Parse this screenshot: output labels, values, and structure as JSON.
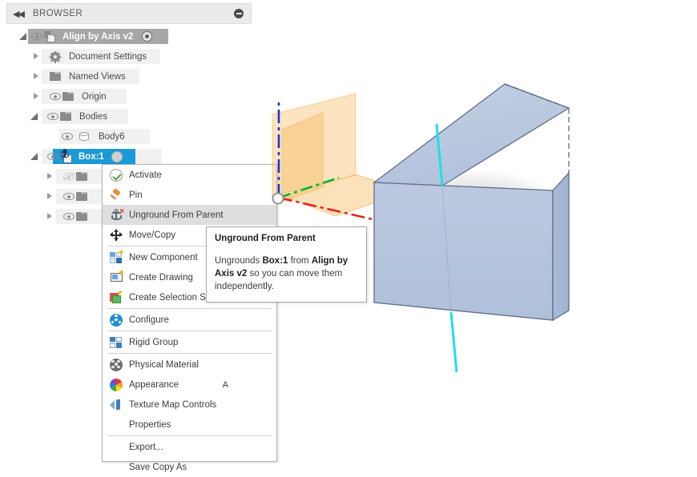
{
  "panel": {
    "header": {
      "title": "BROWSER",
      "collapse_icon": "double-chevron-left-icon",
      "minimize_icon": "minus-circle-icon"
    },
    "tree": [
      {
        "label": "Align by Axis v2",
        "indent": 0,
        "state": "root-active",
        "icons": [
          "expand-open-icon",
          "eye-icon",
          "component-icon",
          "activated-target-icon"
        ]
      },
      {
        "label": "Document Settings",
        "indent": 1,
        "state": "normal",
        "icons": [
          "expand-collapsed-icon",
          "gear-icon"
        ]
      },
      {
        "label": "Named Views",
        "indent": 1,
        "state": "normal",
        "icons": [
          "expand-collapsed-icon",
          "folder-icon"
        ]
      },
      {
        "label": "Origin",
        "indent": 1,
        "state": "normal",
        "icons": [
          "expand-collapsed-icon",
          "eye-icon",
          "folder-icon"
        ]
      },
      {
        "label": "Bodies",
        "indent": 1,
        "state": "normal",
        "icons": [
          "expand-open-icon",
          "eye-icon",
          "folder-icon"
        ]
      },
      {
        "label": "Body6",
        "indent": 2,
        "state": "normal",
        "icons": [
          "eye-icon",
          "body-cylinder-icon"
        ]
      },
      {
        "label": "Box:1",
        "indent": 1,
        "state": "selected",
        "icons": [
          "expand-open-icon",
          "eye-icon",
          "grounded-component-icon",
          "grey-ball-icon"
        ]
      },
      {
        "label": "",
        "indent": 2,
        "state": "hidden-row",
        "icons": [
          "expand-collapsed-icon",
          "eye-off-icon",
          "folder-icon"
        ]
      },
      {
        "label": "",
        "indent": 2,
        "state": "hidden-row",
        "icons": [
          "expand-collapsed-icon",
          "eye-icon",
          "folder-icon"
        ]
      },
      {
        "label": "",
        "indent": 2,
        "state": "hidden-row",
        "icons": [
          "expand-collapsed-icon",
          "eye-icon",
          "folder-icon"
        ]
      }
    ]
  },
  "context_menu": {
    "items": [
      {
        "label": "Activate",
        "icon": "check-circle-icon",
        "accel": "",
        "highlighted": false,
        "separator_after": false
      },
      {
        "label": "Pin",
        "icon": "pin-icon",
        "accel": "",
        "highlighted": false,
        "separator_after": false
      },
      {
        "label": "Unground From Parent",
        "icon": "anchor-remove-icon",
        "accel": "",
        "highlighted": true,
        "separator_after": false
      },
      {
        "label": "Move/Copy",
        "icon": "move-arrows-icon",
        "accel": "",
        "highlighted": false,
        "separator_after": true
      },
      {
        "label": "New Component",
        "icon": "new-component-icon",
        "accel": "",
        "highlighted": false,
        "separator_after": false
      },
      {
        "label": "Create Drawing",
        "icon": "create-drawing-icon",
        "accel": "",
        "highlighted": false,
        "separator_after": false
      },
      {
        "label": "Create Selection Set",
        "icon": "selection-set-icon",
        "accel": "",
        "highlighted": false,
        "separator_after": true
      },
      {
        "label": "Configure",
        "icon": "configure-icon",
        "accel": "",
        "highlighted": false,
        "separator_after": true
      },
      {
        "label": "Rigid Group",
        "icon": "rigid-group-icon",
        "accel": "",
        "highlighted": false,
        "separator_after": true
      },
      {
        "label": "Physical Material",
        "icon": "physical-material-icon",
        "accel": "",
        "highlighted": false,
        "separator_after": false
      },
      {
        "label": "Appearance",
        "icon": "appearance-icon",
        "accel": "A",
        "highlighted": false,
        "separator_after": false
      },
      {
        "label": "Texture Map Controls",
        "icon": "texture-map-icon",
        "accel": "",
        "highlighted": false,
        "separator_after": false
      },
      {
        "label": "Properties",
        "icon": "",
        "accel": "",
        "highlighted": false,
        "separator_after": true
      },
      {
        "label": "Export...",
        "icon": "",
        "accel": "",
        "highlighted": false,
        "separator_after": false
      },
      {
        "label": "Save Copy As",
        "icon": "",
        "accel": "",
        "highlighted": false,
        "separator_after": false
      }
    ]
  },
  "tooltip": {
    "title": "Unground From Parent",
    "body_parts": [
      {
        "text": "Ungrounds ",
        "bold": false
      },
      {
        "text": "Box:1",
        "bold": true
      },
      {
        "text": " from ",
        "bold": false
      },
      {
        "text": "Align by Axis v2",
        "bold": true
      },
      {
        "text": " so you can move them independently.",
        "bold": false
      }
    ]
  },
  "viewport": {
    "description": "3D modeling canvas showing a grounded box body and origin planes",
    "origin_marker": "origin-point-icon",
    "axes": [
      {
        "name": "x-axis",
        "color": "#e8231f"
      },
      {
        "name": "y-axis",
        "color": "#00b23b"
      },
      {
        "name": "z-axis",
        "color": "#1a38d8"
      }
    ],
    "highlight_axis": {
      "name": "selected-axis",
      "color": "#1ae0ef"
    },
    "origin_planes_color": "#f5b95c",
    "box_face_color": "#b6c5de",
    "box_edge_color": "#5b6a86"
  }
}
